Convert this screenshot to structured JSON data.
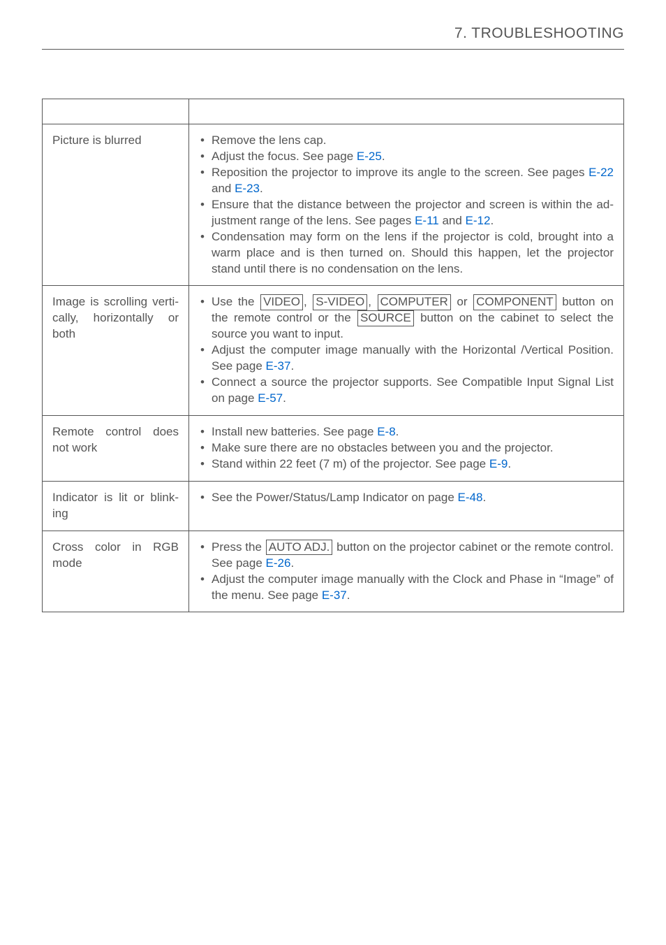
{
  "section": {
    "heading": "7. TROUBLESHOOTING"
  },
  "links": {
    "E8": "E-8",
    "E9": "E-9",
    "E11": "E-11",
    "E12": "E-12",
    "E22": "E-22",
    "E23": "E-23",
    "E25": "E-25",
    "E26": "E-26",
    "E37": "E-37",
    "E48": "E-48",
    "E57": "E-57"
  },
  "keys": {
    "VIDEO": "VIDEO",
    "SVIDEO": "S-VIDEO",
    "COMPUTER": "COMPUTER",
    "COMPONENT": "COMPONENT",
    "SOURCE": "SOURCE",
    "AUTOADJ": "AUTO ADJ."
  },
  "rows": {
    "r1": {
      "problem": "Picture is blurred",
      "b1": "Remove the lens cap.",
      "b2_a": "Adjust the focus. See page ",
      "b2_b": ".",
      "b3_a": "Reposition the projector to improve its angle to the screen. See pages ",
      "b3_b": " and ",
      "b3_c": ".",
      "b4_a": "Ensure that the distance between the projector and screen is within the ad­justment range of the lens. See pages ",
      "b4_b": " and ",
      "b4_c": ".",
      "b5": "Condensation may form on the lens if the projector is cold, brought into a warm place and is then turned on. Should this happen, let the projector stand until there is no condensation on the lens."
    },
    "r2": {
      "problem": "Image is scrolling verti­cally, horizontally or both",
      "b1_a": "Use the ",
      "b1_b": ", ",
      "b1_c": " or ",
      "b1_d": " button on the re­mote control or the ",
      "b1_e": " button on the cabinet to select the source you want to input.",
      "b2_a": "Adjust the computer image manually with the Horizontal /Vertical Position. See page ",
      "b2_b": ".",
      "b3_a": "Connect a source the projector supports. See Compatible Input Signal List on page ",
      "b3_b": "."
    },
    "r3": {
      "problem": "Remote control does not work",
      "b1_a": "Install new batteries. See page ",
      "b1_b": ".",
      "b2": "Make sure there are no obstacles between you and the projector.",
      "b3_a": "Stand within 22 feet (7 m) of the projector. See page ",
      "b3_b": "."
    },
    "r4": {
      "problem": "Indicator is lit or blink­ing",
      "b1_a": "See the Power/Status/Lamp Indicator on page ",
      "b1_b": "."
    },
    "r5": {
      "problem": "Cross color in RGB mode",
      "b1_a": "Press the ",
      "b1_b": " button on the projector cabinet or the remote control. See page ",
      "b1_c": ".",
      "b2_a": "Adjust the computer image manually with the Clock and Phase in “Image” of the menu. See page ",
      "b2_b": "."
    }
  }
}
